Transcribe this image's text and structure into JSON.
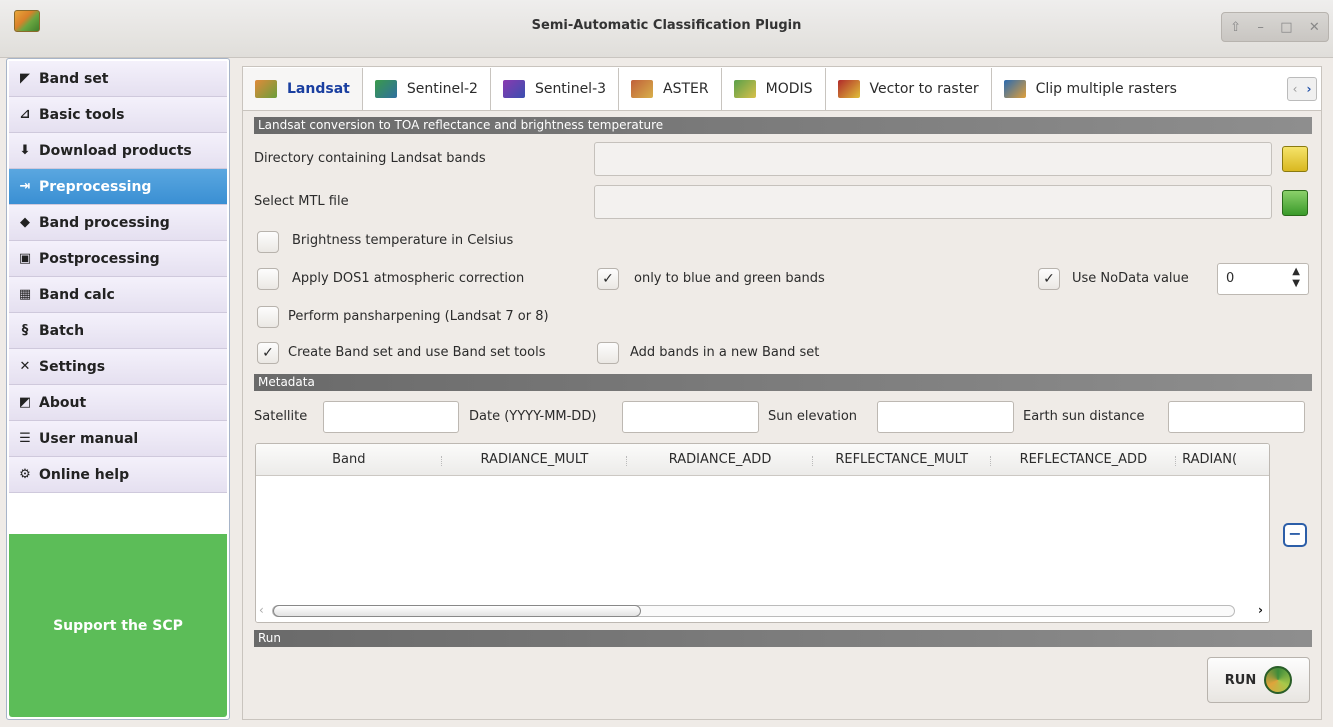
{
  "window": {
    "title": "Semi-Automatic Classification Plugin"
  },
  "sidebar": {
    "items": [
      {
        "label": "Band set",
        "icon": "band-set-icon"
      },
      {
        "label": "Basic tools",
        "icon": "basic-tools-icon"
      },
      {
        "label": "Download products",
        "icon": "download-icon"
      },
      {
        "label": "Preprocessing",
        "icon": "preprocessing-icon",
        "active": true
      },
      {
        "label": "Band processing",
        "icon": "band-processing-icon"
      },
      {
        "label": "Postprocessing",
        "icon": "postprocessing-icon"
      },
      {
        "label": "Band calc",
        "icon": "calculator-icon"
      },
      {
        "label": "Batch",
        "icon": "batch-icon"
      },
      {
        "label": "Settings",
        "icon": "settings-icon"
      },
      {
        "label": "About",
        "icon": "about-icon"
      },
      {
        "label": "User manual",
        "icon": "manual-icon"
      },
      {
        "label": "Online help",
        "icon": "help-icon"
      }
    ],
    "support": "Support the SCP"
  },
  "tabs": [
    {
      "label": "Landsat",
      "active": true
    },
    {
      "label": "Sentinel-2"
    },
    {
      "label": "Sentinel-3"
    },
    {
      "label": "ASTER"
    },
    {
      "label": "MODIS"
    },
    {
      "label": "Vector to raster"
    },
    {
      "label": "Clip multiple rasters"
    }
  ],
  "landsat": {
    "section_title": "Landsat conversion to TOA reflectance and brightness temperature",
    "dir_label": "Directory containing Landsat bands",
    "dir_value": "",
    "mtl_label": "Select MTL file",
    "mtl_value": "",
    "brightness_celsius": "Brightness temperature in Celsius",
    "dos1": "Apply DOS1 atmospheric correction",
    "only_blue_green": "only to blue and green bands",
    "use_nodata": "Use NoData value",
    "nodata_value": "0",
    "pansharpening": "Perform pansharpening (Landsat 7 or 8)",
    "create_bandset": "Create Band set and use Band set tools",
    "add_bands_new": "Add bands in a new Band set"
  },
  "metadata": {
    "section_title": "Metadata",
    "satellite_label": "Satellite",
    "satellite_value": "",
    "date_label": "Date (YYYY-MM-DD)",
    "date_value": "",
    "sun_elevation_label": "Sun elevation",
    "sun_elevation_value": "",
    "earth_sun_label": "Earth sun distance",
    "earth_sun_value": "",
    "columns": [
      "Band",
      "RADIANCE_MULT",
      "RADIANCE_ADD",
      "REFLECTANCE_MULT",
      "REFLECTANCE_ADD",
      "RADIAN("
    ]
  },
  "run": {
    "section_title": "Run",
    "button_label": "RUN"
  },
  "checkbox_mark": "✓",
  "colors": {
    "accent": "#3a8fd3",
    "support": "#5cbd58",
    "tab_active": "#1a3fa0"
  }
}
